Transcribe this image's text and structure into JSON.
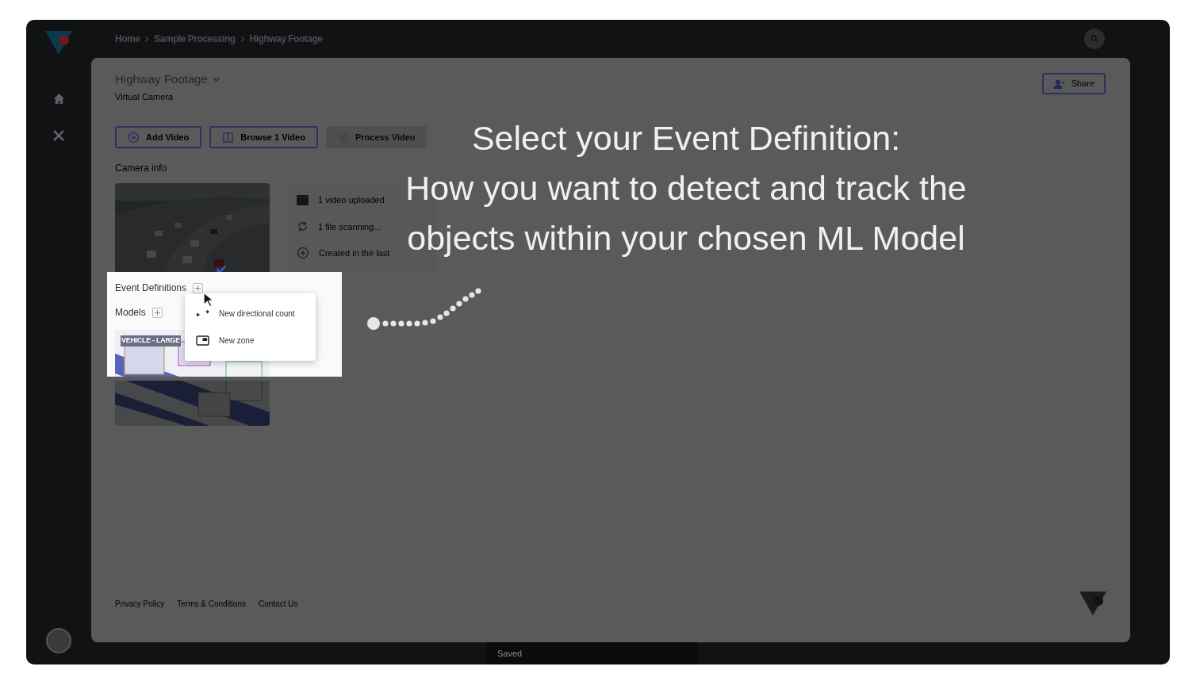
{
  "breadcrumbs": [
    "Home",
    "Sample Processing",
    "Highway Footage"
  ],
  "header": {
    "title": "Highway Footage",
    "subtitle": "Virtual Camera",
    "share_button": "Share"
  },
  "actions": [
    {
      "kind": "add",
      "label": "Add Video",
      "disabled": false
    },
    {
      "kind": "browse",
      "label": "Browse 1 Video",
      "disabled": false
    },
    {
      "kind": "process",
      "label": "Process Video",
      "disabled": true
    }
  ],
  "camera_info": {
    "heading": "Camera info",
    "items": [
      {
        "kind": "video",
        "text": "1 video uploaded"
      },
      {
        "kind": "scan",
        "text": "1 file scanning..."
      },
      {
        "kind": "created",
        "text": "Created in the last"
      }
    ]
  },
  "spotlight": {
    "sections": [
      "Event Definitions",
      "Models"
    ],
    "model_tag": "VEHICLE - LARGE",
    "menu": [
      {
        "kind": "directional",
        "label": "New directional count"
      },
      {
        "kind": "zone",
        "label": "New zone"
      }
    ]
  },
  "tutorial": {
    "lines": [
      "Select your Event Definition:",
      "How you want to detect and track the",
      "objects within your chosen ML Model"
    ]
  },
  "footer_links": [
    "Privacy Policy",
    "Terms & Conditions",
    "Contact Us"
  ],
  "toast": "Saved"
}
